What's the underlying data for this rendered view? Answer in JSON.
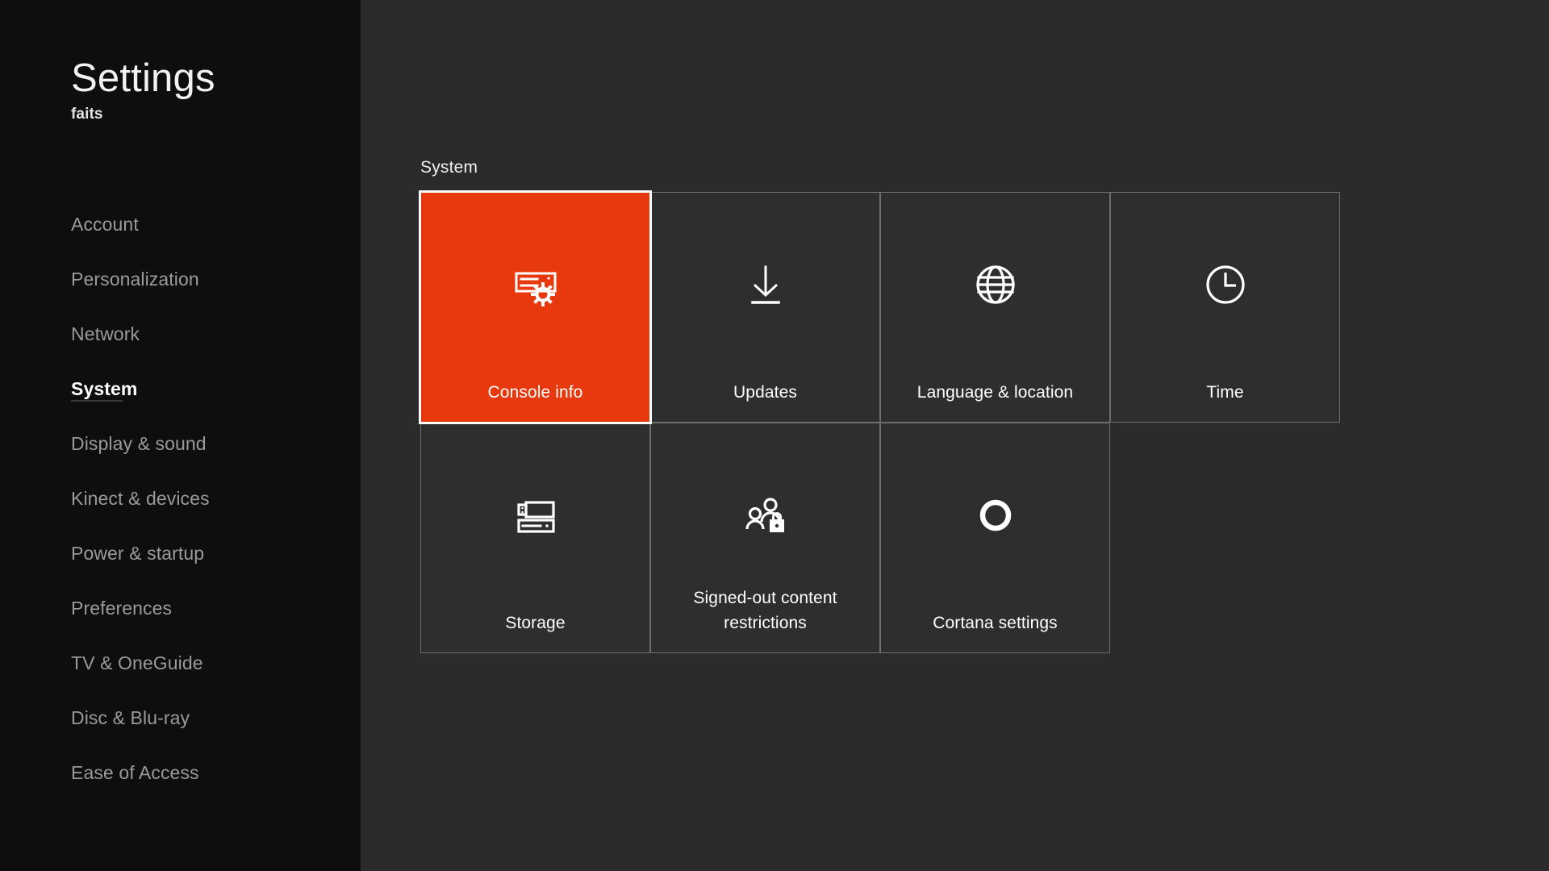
{
  "sidebar": {
    "title": "Settings",
    "subtitle": "faits",
    "items": [
      {
        "label": "Account",
        "active": false
      },
      {
        "label": "Personalization",
        "active": false
      },
      {
        "label": "Network",
        "active": false
      },
      {
        "label": "System",
        "active": true
      },
      {
        "label": "Display & sound",
        "active": false
      },
      {
        "label": "Kinect & devices",
        "active": false
      },
      {
        "label": "Power & startup",
        "active": false
      },
      {
        "label": "Preferences",
        "active": false
      },
      {
        "label": "TV & OneGuide",
        "active": false
      },
      {
        "label": "Disc & Blu-ray",
        "active": false
      },
      {
        "label": "Ease of Access",
        "active": false
      }
    ]
  },
  "content": {
    "section_heading": "System",
    "tiles": [
      {
        "label": "Console info",
        "icon": "console-info-icon",
        "selected": true
      },
      {
        "label": "Updates",
        "icon": "download-arrow-icon",
        "selected": false
      },
      {
        "label": "Language & location",
        "icon": "globe-icon",
        "selected": false
      },
      {
        "label": "Time",
        "icon": "clock-icon",
        "selected": false
      },
      {
        "label": "Storage",
        "icon": "storage-drive-icon",
        "selected": false
      },
      {
        "label": "Signed-out content restrictions",
        "icon": "people-lock-icon",
        "selected": false
      },
      {
        "label": "Cortana settings",
        "icon": "cortana-ring-icon",
        "selected": false
      }
    ]
  },
  "colors": {
    "accent_orange": "#e8380d",
    "sidebar_bg": "#0e0e0e",
    "content_bg": "#2b2b2b",
    "tile_bg": "#2e2e2e",
    "tile_border": "#6e6e6e",
    "focus_border": "#ffffff",
    "nav_inactive": "#9a9a9a",
    "nav_active": "#ffffff"
  }
}
